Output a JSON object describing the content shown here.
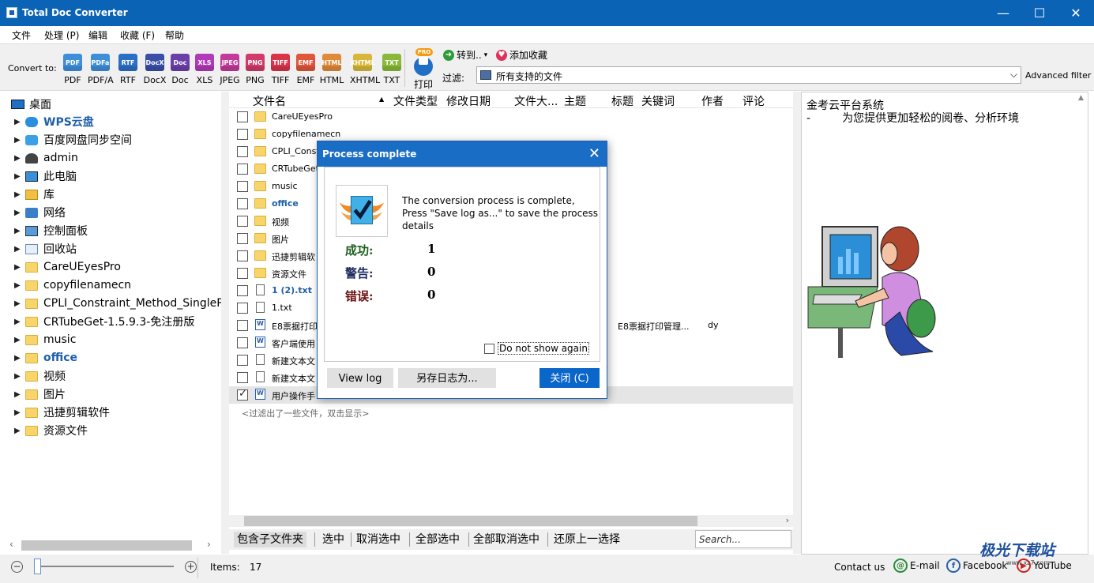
{
  "window": {
    "title": "Total Doc Converter",
    "minimize": "—",
    "maximize": "☐",
    "close": "✕"
  },
  "menu": [
    "文件",
    "处理 (P)",
    "编辑",
    "收藏 (F)",
    "帮助"
  ],
  "toolbar": {
    "convert_to_label": "Convert to:",
    "formats": [
      {
        "icon": "PDF",
        "label": "PDF",
        "color": "#3f8fd8"
      },
      {
        "icon": "PDFa",
        "label": "PDF/A",
        "color": "#3f8fd8"
      },
      {
        "icon": "RTF",
        "label": "RTF",
        "color": "#2b6fc4"
      },
      {
        "icon": "DocX",
        "label": "DocX",
        "color": "#3a4fa8"
      },
      {
        "icon": "Doc",
        "label": "Doc",
        "color": "#6a3fa8"
      },
      {
        "icon": "XLS",
        "label": "XLS",
        "color": "#b03ab8"
      },
      {
        "icon": "JPEG",
        "label": "JPEG",
        "color": "#c23a9a"
      },
      {
        "icon": "PNG",
        "label": "PNG",
        "color": "#d23a6a"
      },
      {
        "icon": "TIFF",
        "label": "TIFF",
        "color": "#d8344a"
      },
      {
        "icon": "EMF",
        "label": "EMF",
        "color": "#e0563a"
      },
      {
        "icon": "HTML",
        "label": "HTML",
        "color": "#e08a3a"
      },
      {
        "icon": "XHTML",
        "label": "XHTML",
        "color": "#d8b83a"
      },
      {
        "icon": "TXT",
        "label": "TXT",
        "color": "#8ab83a"
      }
    ],
    "print_badge": "PRO",
    "print_label": "打印",
    "goto_label": "转到..",
    "goto_arrow": "▾",
    "add_fav_label": "添加收藏",
    "filter_label": "过滤:",
    "filter_value": "所有支持的文件",
    "filter_arrow": "⌵",
    "advanced_filter": "Advanced filter"
  },
  "tree": {
    "root": "桌面",
    "expander": "▶",
    "items": [
      {
        "label": "WPS云盘",
        "icon": "cloud-icon",
        "highlight": true
      },
      {
        "label": "百度网盘同步空间",
        "icon": "baidu-netdisk-icon",
        "highlight": false
      },
      {
        "label": "admin",
        "icon": "user-icon",
        "highlight": false
      },
      {
        "label": "此电脑",
        "icon": "computer-icon",
        "highlight": false
      },
      {
        "label": "库",
        "icon": "library-icon",
        "highlight": false
      },
      {
        "label": "网络",
        "icon": "network-icon",
        "highlight": false
      },
      {
        "label": "控制面板",
        "icon": "control-panel-icon",
        "highlight": false
      },
      {
        "label": "回收站",
        "icon": "recycle-bin-icon",
        "highlight": false
      },
      {
        "label": "CareUEyesPro",
        "icon": "folder-icon",
        "highlight": false
      },
      {
        "label": "copyfilenamecn",
        "icon": "folder-icon",
        "highlight": false
      },
      {
        "label": "CPLI_Constraint_Method_SinglePagePD",
        "icon": "folder-icon",
        "highlight": false
      },
      {
        "label": "CRTubeGet-1.5.9.3-免注册版",
        "icon": "folder-icon",
        "highlight": false
      },
      {
        "label": "music",
        "icon": "folder-icon",
        "highlight": false
      },
      {
        "label": "office",
        "icon": "folder-icon",
        "highlight": true
      },
      {
        "label": "视频",
        "icon": "folder-icon",
        "highlight": false
      },
      {
        "label": "图片",
        "icon": "folder-icon",
        "highlight": false
      },
      {
        "label": "迅捷剪辑软件",
        "icon": "folder-icon",
        "highlight": false
      },
      {
        "label": "资源文件",
        "icon": "folder-icon",
        "highlight": false
      }
    ],
    "scroll_left": "‹",
    "scroll_right": "›"
  },
  "filelist": {
    "columns": [
      "文件名",
      "文件类型",
      "修改日期",
      "文件大...",
      "主题",
      "标题",
      "关键词",
      "作者",
      "评论"
    ],
    "sort_arrow": "▲",
    "rows": [
      {
        "name": "CareUEyesPro",
        "type": "folder",
        "checked": false,
        "highlight": false
      },
      {
        "name": "copyfilenamecn",
        "type": "folder",
        "checked": false,
        "highlight": false
      },
      {
        "name": "CPLI_Const",
        "type": "folder",
        "checked": false,
        "highlight": false
      },
      {
        "name": "CRTubeGet",
        "type": "folder",
        "checked": false,
        "highlight": false
      },
      {
        "name": "music",
        "type": "folder",
        "checked": false,
        "highlight": false
      },
      {
        "name": "office",
        "type": "folder",
        "checked": false,
        "highlight": true
      },
      {
        "name": "视频",
        "type": "folder",
        "checked": false,
        "highlight": false
      },
      {
        "name": "图片",
        "type": "folder",
        "checked": false,
        "highlight": false
      },
      {
        "name": "迅捷剪辑软",
        "type": "folder",
        "checked": false,
        "highlight": false
      },
      {
        "name": "资源文件",
        "type": "folder",
        "checked": false,
        "highlight": false
      },
      {
        "name": "1 (2).txt",
        "type": "txt",
        "checked": false,
        "highlight": true
      },
      {
        "name": "1.txt",
        "type": "txt",
        "checked": false,
        "highlight": false
      },
      {
        "name": "E8票据打印",
        "type": "doc",
        "checked": false,
        "highlight": false,
        "title": "E8票据打印管理...",
        "author": "dy"
      },
      {
        "name": "客户端使用",
        "type": "doc",
        "checked": false,
        "highlight": false
      },
      {
        "name": "新建文本文",
        "type": "txt",
        "checked": false,
        "highlight": false
      },
      {
        "name": "新建文本文",
        "type": "txt",
        "checked": false,
        "highlight": false
      },
      {
        "name": "用户操作手",
        "type": "doc",
        "checked": true,
        "highlight": false,
        "selected": true
      }
    ],
    "filtered_note": "<过滤出了一些文件，双击显示>",
    "scroll_right": "›"
  },
  "selection_bar": {
    "buttons": [
      "包含子文件夹",
      "选中",
      "取消选中",
      "全部选中",
      "全部取消选中",
      "还原上一选择"
    ],
    "search_placeholder": "Search..."
  },
  "preview": {
    "line1": "金考云平台系统",
    "line2": "-         为您提供更加轻松的阅卷、分析环境",
    "scroll_up": "▲"
  },
  "dialog": {
    "title": "Process complete",
    "close": "✕",
    "message": "The conversion process is complete, Press \"Save log as...\" to save the process details",
    "stats": [
      {
        "label": "成功:",
        "value": "1",
        "color": "#1d5e1d"
      },
      {
        "label": "警告:",
        "value": "0",
        "color": "#1d2a5e"
      },
      {
        "label": "错误:",
        "value": "0",
        "color": "#6b1010"
      }
    ],
    "dont_show": "Do not show again",
    "view_log": "View log",
    "save_log": "另存日志为...",
    "close_btn": "关闭 (C)"
  },
  "statusbar": {
    "zoom_out": "−",
    "zoom_in": "+",
    "items_label": "Items:",
    "items_value": "17",
    "contact": "Contact us",
    "email": "E-mail",
    "facebook": "Facebook",
    "youtube": "YouTube"
  },
  "watermark": {
    "text": "极光下载站",
    "sub": "www.xz7.com"
  }
}
